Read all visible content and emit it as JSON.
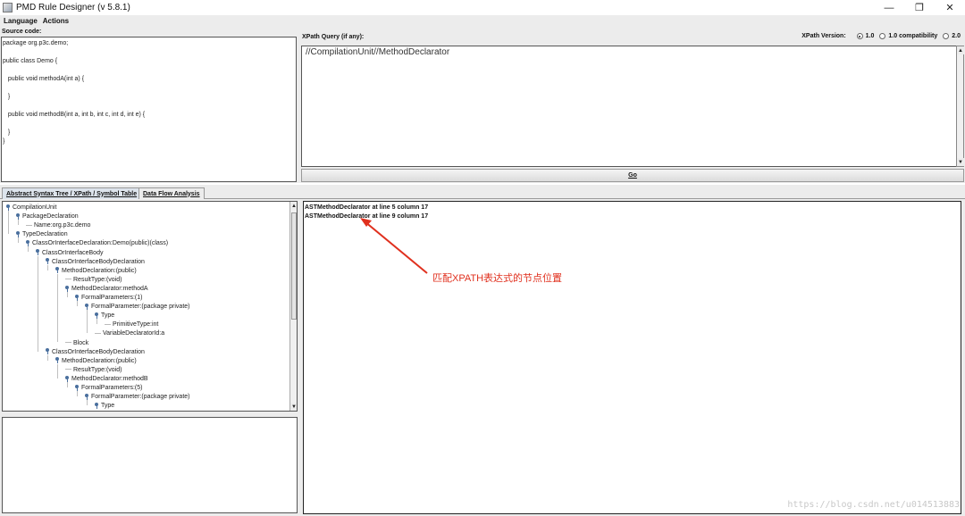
{
  "window": {
    "title": "PMD Rule Designer (v 5.8.1)",
    "minimize_glyph": "—",
    "restore_glyph": "❐",
    "close_glyph": "✕"
  },
  "menu": [
    "Language",
    "Actions"
  ],
  "source": {
    "label": "Source code:",
    "lines": [
      "package org.p3c.demo;",
      "",
      "public class Demo {",
      "",
      "   public void methodA(int a) {",
      "",
      "   }",
      "",
      "   public void methodB(int a, int b, int c, int d, int e) {",
      "",
      "   }",
      "}"
    ]
  },
  "xpath": {
    "label": "XPath Query (if any):",
    "version_label": "XPath Version:",
    "options": [
      {
        "label": "1.0",
        "checked": true
      },
      {
        "label": "1.0 compatibility",
        "checked": false
      },
      {
        "label": "2.0",
        "checked": false
      }
    ],
    "query": "//CompilationUnit//MethodDeclarator",
    "go_label": "Go"
  },
  "tabs": [
    {
      "label": "Abstract Syntax Tree / XPath / Symbol Table",
      "active": true
    },
    {
      "label": "Data Flow Analysis",
      "active": false
    }
  ],
  "tree": [
    {
      "label": "CompilationUnit",
      "depth": 0,
      "branch": true
    },
    {
      "label": "PackageDeclaration",
      "depth": 1,
      "branch": true
    },
    {
      "label": "Name:org.p3c.demo",
      "depth": 2,
      "branch": false
    },
    {
      "label": "TypeDeclaration",
      "depth": 1,
      "branch": true
    },
    {
      "label": "ClassOrInterfaceDeclaration:Demo(public)(class)",
      "depth": 2,
      "branch": true
    },
    {
      "label": "ClassOrInterfaceBody",
      "depth": 3,
      "branch": true
    },
    {
      "label": "ClassOrInterfaceBodyDeclaration",
      "depth": 4,
      "branch": true
    },
    {
      "label": "MethodDeclaration:(public)",
      "depth": 5,
      "branch": true
    },
    {
      "label": "ResultType:(void)",
      "depth": 6,
      "branch": false
    },
    {
      "label": "MethodDeclarator:methodA",
      "depth": 6,
      "branch": true
    },
    {
      "label": "FormalParameters:(1)",
      "depth": 7,
      "branch": true
    },
    {
      "label": "FormalParameter:(package private)",
      "depth": 8,
      "branch": true
    },
    {
      "label": "Type",
      "depth": 9,
      "branch": true
    },
    {
      "label": "PrimitiveType:int",
      "depth": 10,
      "branch": false
    },
    {
      "label": "VariableDeclaratorId:a",
      "depth": 9,
      "branch": false
    },
    {
      "label": "Block",
      "depth": 6,
      "branch": false
    },
    {
      "label": "ClassOrInterfaceBodyDeclaration",
      "depth": 4,
      "branch": true
    },
    {
      "label": "MethodDeclaration:(public)",
      "depth": 5,
      "branch": true
    },
    {
      "label": "ResultType:(void)",
      "depth": 6,
      "branch": false
    },
    {
      "label": "MethodDeclarator:methodB",
      "depth": 6,
      "branch": true
    },
    {
      "label": "FormalParameters:(5)",
      "depth": 7,
      "branch": true
    },
    {
      "label": "FormalParameter:(package private)",
      "depth": 8,
      "branch": true
    },
    {
      "label": "Type",
      "depth": 9,
      "branch": true
    }
  ],
  "results": [
    "ASTMethodDeclarator at line 5 column 17",
    "ASTMethodDeclarator at line 9 column 17"
  ],
  "annotation": "匹配XPATH表达式的节点位置",
  "watermark": "https://blog.csdn.net/u014513883",
  "colors": {
    "annotation": "#e0301e",
    "tree_handle": "#4a6f9e"
  }
}
